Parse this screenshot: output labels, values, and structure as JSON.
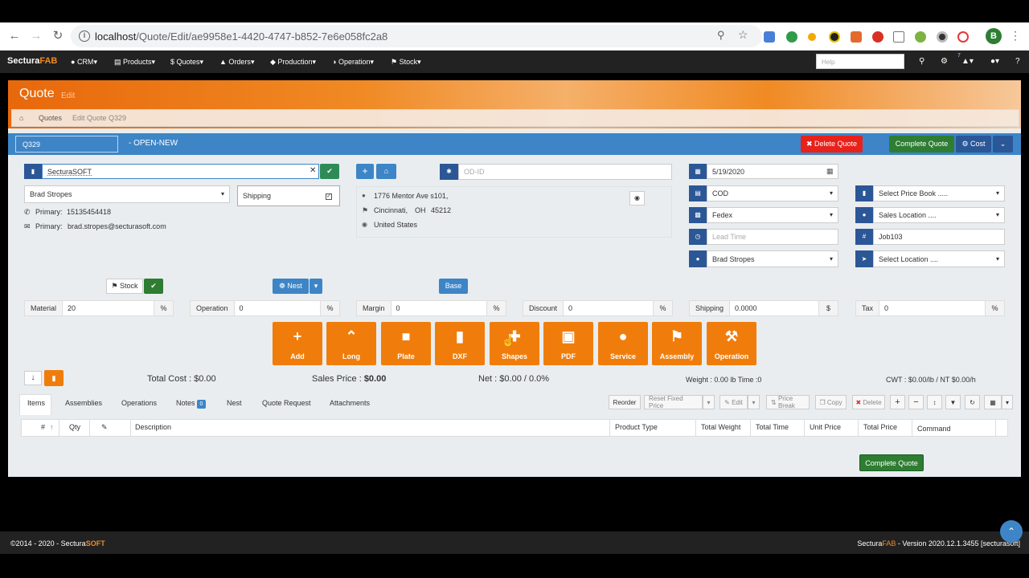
{
  "browser": {
    "url_host": "localhost",
    "url_path": "/Quote/Edit/ae9958e1-4420-4747-b852-7e6e058fc2a8",
    "profile_initial": "B"
  },
  "nav": {
    "brand_a": "Sectura",
    "brand_b": "FAB",
    "menus": [
      "CRM",
      "Products",
      "Quotes",
      "Orders",
      "Production",
      "Operation",
      "Stock"
    ],
    "help_placeholder": "Help",
    "notif_count": "7"
  },
  "page": {
    "title": "Quote",
    "subtitle": "Edit",
    "breadcrumb": [
      "Quotes",
      "Edit Quote Q329"
    ]
  },
  "header": {
    "quote_no": "Q329",
    "status": "- OPEN-NEW",
    "delete_label": "Delete Quote",
    "complete_label": "Complete Quote",
    "cost_label": "Cost"
  },
  "customer": {
    "company": "SecturaSOFT",
    "contact": "Brad Stropes",
    "shipping_label": "Shipping",
    "phone_label": "Primary:",
    "phone": "15135454418",
    "email_label": "Primary:",
    "email": "brad.stropes@secturasoft.com"
  },
  "address": {
    "street": "1776 Mentor Ave s101,",
    "city": "Cincinnati,",
    "state": "OH",
    "zip": "45212",
    "country": "United States"
  },
  "order": {
    "odid_placeholder": "OD-ID",
    "date": "5/19/2020",
    "terms": "COD",
    "carrier": "Fedex",
    "lead_time_placeholder": "Lead Time",
    "salesperson": "Brad Stropes",
    "price_book": "Select Price Book .....",
    "sales_location": "Sales Location ....",
    "job": "Job103",
    "location": "Select Location ...."
  },
  "toolbar2": {
    "stock": "Stock",
    "nest": "Nest",
    "base": "Base"
  },
  "rates": [
    {
      "label": "Material",
      "value": "20",
      "unit": "%"
    },
    {
      "label": "Operation",
      "value": "0",
      "unit": "%"
    },
    {
      "label": "Margin",
      "value": "0",
      "unit": "%"
    },
    {
      "label": "Discount",
      "value": "0",
      "unit": "%"
    },
    {
      "label": "Shipping",
      "value": "0.0000",
      "unit": "$"
    },
    {
      "label": "Tax",
      "value": "0",
      "unit": "%"
    }
  ],
  "tiles": [
    "Add",
    "Long",
    "Plate",
    "DXF",
    "Shapes",
    "PDF",
    "Service",
    "Assembly",
    "Operation"
  ],
  "totals": {
    "total_cost": "Total Cost : $0.00",
    "sales_price_label": "Sales Price : ",
    "sales_price": "$0.00",
    "net": "Net : $0.00 / 0.0%",
    "weight": "Weight : 0.00 lb Time :0",
    "cwt": "CWT : $0.00/lb / NT  $0.00/h"
  },
  "tabs": [
    "Items",
    "Assemblies",
    "Operations",
    "Notes",
    "Nest",
    "Quote Request",
    "Attachments"
  ],
  "notes_count": "0",
  "table_tools": {
    "reorder": "Reorder",
    "reset": "Reset Fixed Price",
    "edit": "Edit",
    "price_break": "Price Break",
    "copy": "Copy",
    "delete": "Delete"
  },
  "columns": [
    "#",
    "Qty",
    "Description",
    "Product Type",
    "Total Weight",
    "Total Time",
    "Unit Price",
    "Total Price",
    "Command"
  ],
  "bottom_complete": "Complete Quote",
  "footer": {
    "copyright_a": "©2014 - 2020 - Sectura",
    "copyright_b": "SOFT",
    "version_a": "Sectura",
    "version_b": "FAB",
    "version_c": " - Version 2020.12.1.3455 [secturasoft]"
  },
  "colors": {
    "orange": "#f07d0b",
    "blue": "#3d85c6",
    "navy": "#2b5797",
    "green": "#2e7d32",
    "red": "#e8211b"
  }
}
